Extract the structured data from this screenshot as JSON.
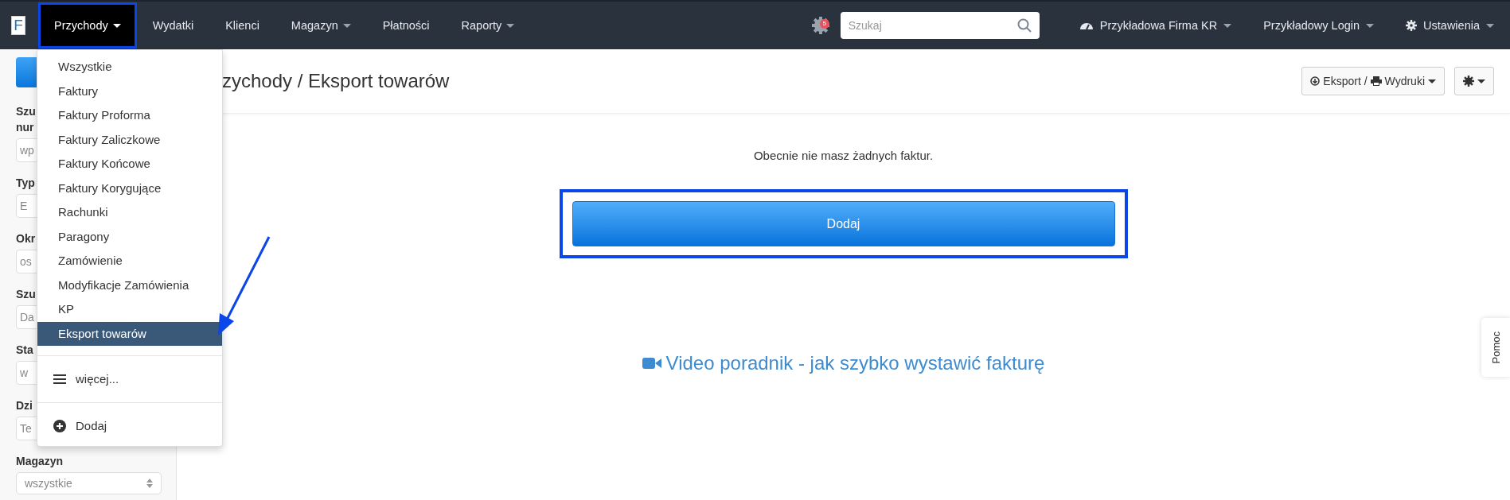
{
  "navbar": {
    "logo": "F",
    "items": [
      {
        "label": "Przychody",
        "selected": true,
        "caret": true
      },
      {
        "label": "Wydatki",
        "selected": false,
        "caret": false
      },
      {
        "label": "Klienci",
        "selected": false,
        "caret": false
      },
      {
        "label": "Magazyn",
        "selected": false,
        "caret": true
      },
      {
        "label": "Płatności",
        "selected": false,
        "caret": false
      },
      {
        "label": "Raporty",
        "selected": false,
        "caret": true
      }
    ],
    "notifications": "5",
    "search": {
      "placeholder": "Szukaj"
    },
    "right_menus": [
      {
        "kind": "company",
        "label": "Przykładowa Firma KR"
      },
      {
        "kind": "user",
        "label": "Przykładowy Login"
      },
      {
        "kind": "settings",
        "label": "Ustawienia"
      }
    ]
  },
  "dropdown": {
    "items": [
      {
        "kind": "link",
        "label": "Wszystkie",
        "selected": false
      },
      {
        "kind": "link",
        "label": "Faktury",
        "selected": false
      },
      {
        "kind": "link",
        "label": "Faktury Proforma",
        "selected": false
      },
      {
        "kind": "link",
        "label": "Faktury Zaliczkowe",
        "selected": false
      },
      {
        "kind": "link",
        "label": "Faktury Końcowe",
        "selected": false
      },
      {
        "kind": "link",
        "label": "Faktury Korygujące",
        "selected": false
      },
      {
        "kind": "link",
        "label": "Rachunki",
        "selected": false
      },
      {
        "kind": "link",
        "label": "Paragony",
        "selected": false
      },
      {
        "kind": "link",
        "label": "Zamówienie",
        "selected": false
      },
      {
        "kind": "link",
        "label": "Modyfikacje Zamówienia",
        "selected": false
      },
      {
        "kind": "link",
        "label": "KP",
        "selected": false
      },
      {
        "kind": "link",
        "label": "Eksport towarów",
        "selected": true
      },
      {
        "kind": "more",
        "label": "więcej..."
      },
      {
        "kind": "add",
        "label": "Dodaj"
      }
    ]
  },
  "sidebar": {
    "fields": [
      {
        "kind": "input",
        "label": "Szu\nnur",
        "value": "wp"
      },
      {
        "kind": "input",
        "label": "Typ",
        "value": "E"
      },
      {
        "kind": "input",
        "label": "Okr",
        "value": "os"
      },
      {
        "kind": "input",
        "label": "Szu",
        "value": "Da"
      },
      {
        "kind": "input",
        "label": "Sta",
        "value": "w"
      },
      {
        "kind": "input",
        "label": "Dzi",
        "value": "Te"
      },
      {
        "kind": "select",
        "label": "Magazyn",
        "value": "wszystkie"
      }
    ]
  },
  "main": {
    "title": "zychody / Eksport towarów",
    "toolbar": [
      {
        "kind": "export",
        "label": "Eksport /",
        "label2": "Wydruki"
      },
      {
        "kind": "gear"
      }
    ],
    "message": "Obecnie nie masz żadnych faktur.",
    "add_button": "Dodaj",
    "video_link": "Video poradnik - jak szybko wystawić fakturę"
  },
  "help_tab": "Pomoc"
}
